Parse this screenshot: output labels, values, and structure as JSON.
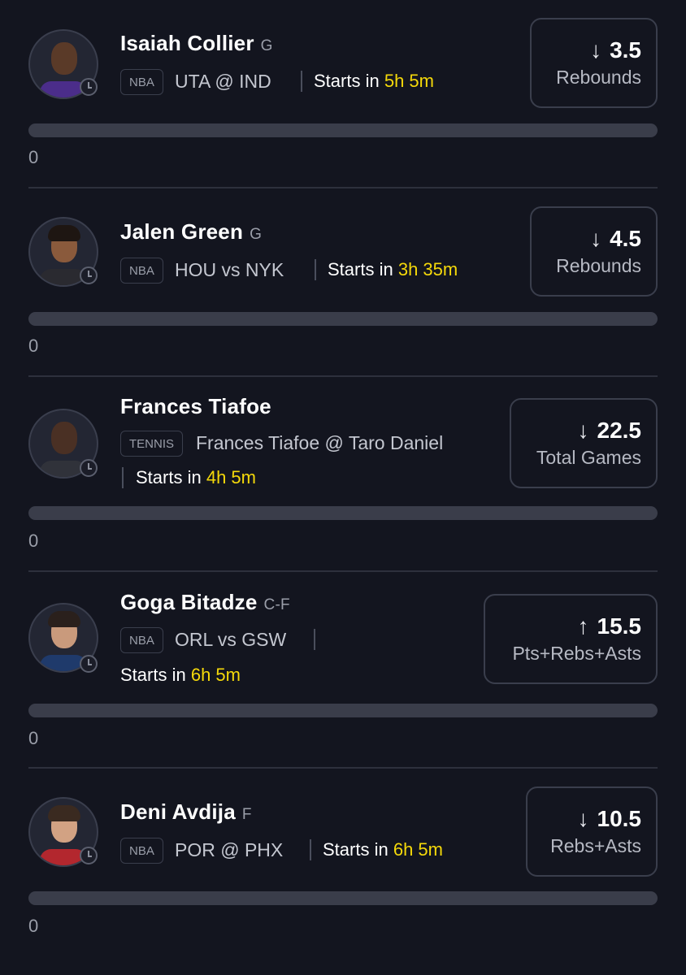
{
  "picks": [
    {
      "name": "Isaiah Collier",
      "position": "G",
      "league": "NBA",
      "matchup": "UTA  @ IND",
      "starts_prefix": "Starts in",
      "starts_time": "5h 5m",
      "direction": "↓",
      "line": "3.5",
      "stat": "Rebounds",
      "progress": "0",
      "jersey_color": "#4b2d8a",
      "skin_color": "#5a3a28"
    },
    {
      "name": "Jalen Green",
      "position": "G",
      "league": "NBA",
      "matchup": "HOU  vs NYK",
      "starts_prefix": "Starts in",
      "starts_time": "3h 35m",
      "direction": "↓",
      "line": "4.5",
      "stat": "Rebounds",
      "progress": "0",
      "jersey_color": "#2a2a30",
      "skin_color": "#8a5a3c"
    },
    {
      "name": "Frances Tiafoe",
      "position": "",
      "league": "TENNIS",
      "matchup": "Frances Tiafoe  @ Taro Daniel",
      "starts_prefix": "Starts in",
      "starts_time": "4h 5m",
      "direction": "↓",
      "line": "22.5",
      "stat": "Total Games",
      "progress": "0",
      "jersey_color": "#30323a",
      "skin_color": "#4a3024"
    },
    {
      "name": "Goga Bitadze",
      "position": "C-F",
      "league": "NBA",
      "matchup": "ORL  vs GSW",
      "starts_prefix": "Starts in",
      "starts_time": "6h 5m",
      "direction": "↑",
      "line": "15.5",
      "stat": "Pts+Rebs+Asts",
      "progress": "0",
      "jersey_color": "#1f3a6b",
      "skin_color": "#c99a7c"
    },
    {
      "name": "Deni Avdija",
      "position": "F",
      "league": "NBA",
      "matchup": "POR  @ PHX",
      "starts_prefix": "Starts in",
      "starts_time": "6h 5m",
      "direction": "↓",
      "line": "10.5",
      "stat": "Rebs+Asts",
      "progress": "0",
      "jersey_color": "#b3272e",
      "skin_color": "#d2a283"
    }
  ],
  "colors": {
    "background": "#13151f",
    "accent_time": "#f5d90a",
    "bar": "#3a3d4a"
  }
}
